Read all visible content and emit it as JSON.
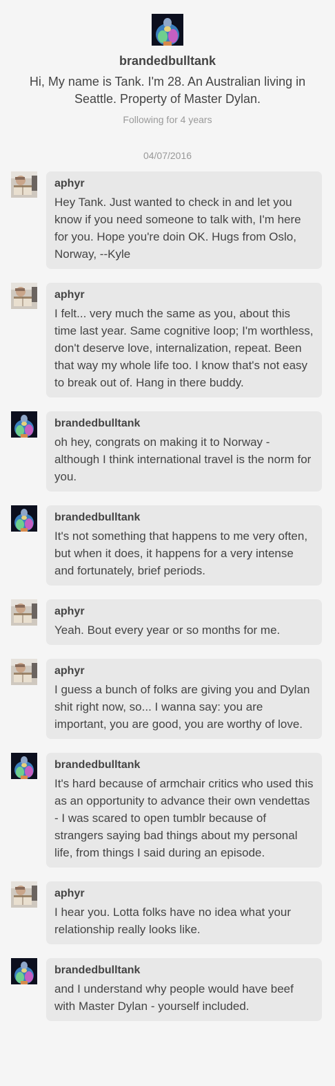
{
  "profile": {
    "username": "brandedbulltank",
    "bio": "Hi, My name is Tank. I'm 28. An Australian living in Seattle. Property of Master Dylan.",
    "following": "Following for 4 years",
    "avatar_icon": "bull-avatar-icon"
  },
  "conversation": {
    "date": "04/07/2016",
    "messages": [
      {
        "sender": "aphyr",
        "avatar": "aphyr",
        "text": "Hey Tank. Just wanted to check in and let you know if you need someone to talk with, I'm here for you. Hope you're doin OK. Hugs from Oslo, Norway, --Kyle"
      },
      {
        "sender": "aphyr",
        "avatar": "aphyr",
        "text": "I felt... very much the same as you, about this time last year. Same cognitive loop; I'm worthless, don't deserve love, internalization, repeat. Been that way my whole life too. I know that's not easy to break out of. Hang in there buddy."
      },
      {
        "sender": "brandedbulltank",
        "avatar": "tank",
        "text": "oh hey, congrats on making it to Norway - although I think international travel is the norm for you."
      },
      {
        "sender": "brandedbulltank",
        "avatar": "tank",
        "text": "It's not something that happens to me very often, but when it does, it happens for a very intense and fortunately, brief periods."
      },
      {
        "sender": "aphyr",
        "avatar": "aphyr",
        "text": "Yeah. Bout every year or so months for me."
      },
      {
        "sender": "aphyr",
        "avatar": "aphyr",
        "text": "I guess a bunch of folks are giving you and Dylan shit right now, so... I wanna say: you are important, you are good, you are worthy of love."
      },
      {
        "sender": "brandedbulltank",
        "avatar": "tank",
        "text": "It's hard because of armchair critics who used this as an opportunity to advance their own vendettas - I was scared to open tumblr because of strangers saying bad things about my personal life, from things I said during an episode."
      },
      {
        "sender": "aphyr",
        "avatar": "aphyr",
        "text": "I hear you. Lotta folks have no idea what your relationship really looks like."
      },
      {
        "sender": "brandedbulltank",
        "avatar": "tank",
        "text": "and I understand why people would have beef with Master Dylan - yourself included."
      }
    ]
  },
  "colors": {
    "page_bg": "#f5f5f5",
    "bubble_bg": "#e8e8e8",
    "text": "#444444",
    "muted": "#999999"
  }
}
